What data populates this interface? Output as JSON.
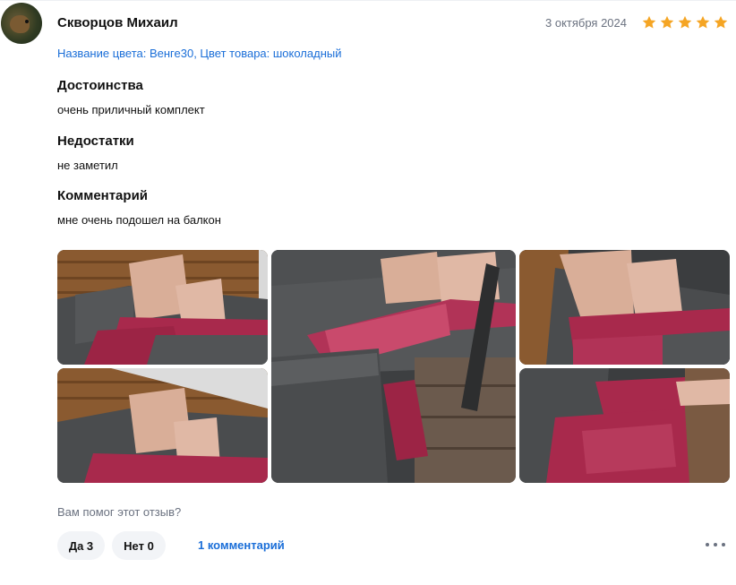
{
  "review": {
    "author": "Скворцов Михаил",
    "date": "3 октября 2024",
    "rating": 5,
    "variant": "Название цвета: Венге30, Цвет товара: шоколадный",
    "pros_title": "Достоинства",
    "pros_text": "очень приличный комплект",
    "cons_title": "Недостатки",
    "cons_text": "не заметил",
    "comment_title": "Комментарий",
    "comment_text": "мне очень подошел на балкон"
  },
  "feedback": {
    "question": "Вам помог этот отзыв?",
    "yes_label": "Да 3",
    "no_label": "Нет 0",
    "comments_link": "1 комментарий"
  },
  "colors": {
    "accent": "#1a6ed8",
    "star": "#f5a524",
    "muted": "#6b7280",
    "pill_bg": "#f2f4f7"
  },
  "icons": {
    "rating": "star-icon",
    "menu": "more-dots-icon"
  }
}
